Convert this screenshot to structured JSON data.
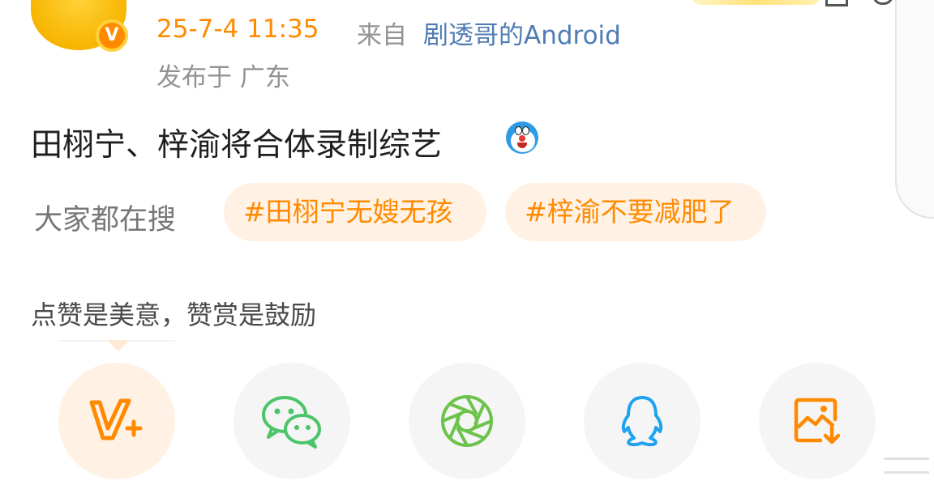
{
  "header": {
    "time": "25-7-4 11:35",
    "source_prefix": "来自",
    "source_name": "剧透哥的Android",
    "location": "发布于 广东",
    "verified_badge": "V"
  },
  "post": {
    "text": "田栩宁、梓渝将合体录制综艺"
  },
  "search": {
    "label": "大家都在搜",
    "tags": [
      "#田栩宁无嫂无孩",
      "#梓渝不要减肥了"
    ]
  },
  "reward": {
    "message": "点赞是美意，赞赏是鼓励"
  },
  "share_buttons": [
    {
      "icon": "reward-v-plus-icon"
    },
    {
      "icon": "wechat-icon"
    },
    {
      "icon": "wechat-moments-icon"
    },
    {
      "icon": "qq-icon"
    },
    {
      "icon": "save-image-icon"
    }
  ],
  "colors": {
    "accent": "#ff8a00",
    "link": "#4f7cb3",
    "muted": "#939393",
    "pill_bg": "#fff1e4",
    "wechat_green": "#4cc46a",
    "moments_green": "#6cc34b",
    "qq_blue": "#1fa3f0"
  }
}
